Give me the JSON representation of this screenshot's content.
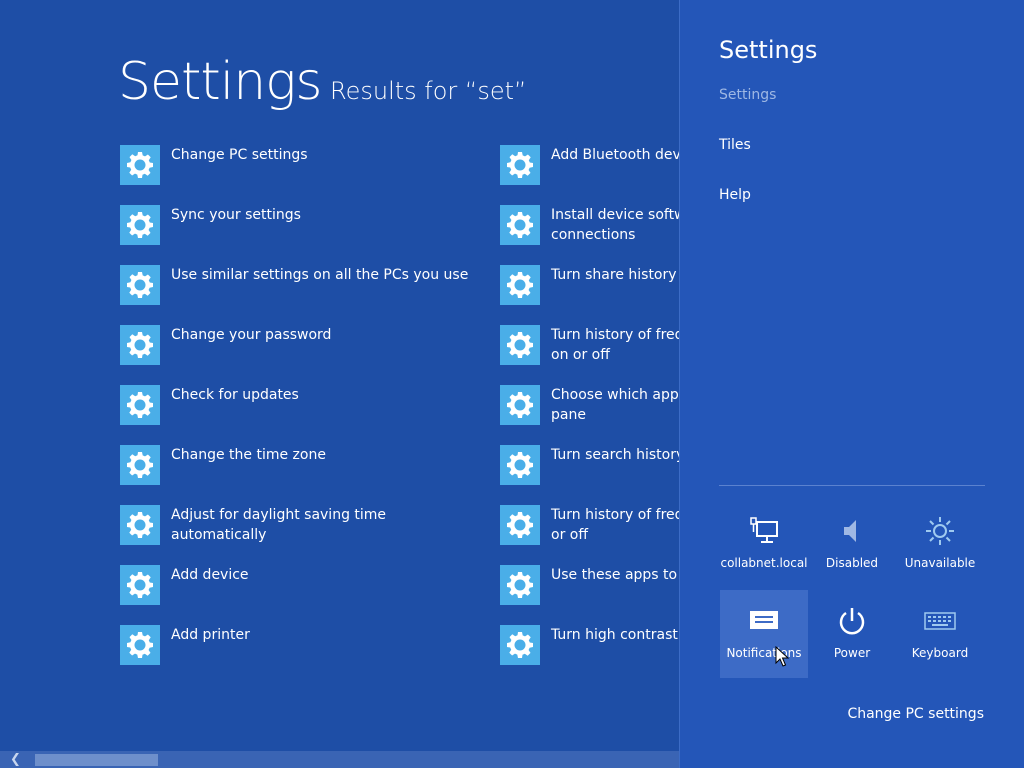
{
  "app": {
    "title": "Settings",
    "subtitle": "Results for “set”"
  },
  "results": {
    "left": [
      {
        "label": "Change PC settings",
        "icon": "gear-icon"
      },
      {
        "label": "Sync your settings",
        "icon": "gear-icon"
      },
      {
        "label": "Use similar settings on all the PCs you use",
        "icon": "gear-icon"
      },
      {
        "label": "Change your password",
        "icon": "gear-icon"
      },
      {
        "label": "Check for updates",
        "icon": "gear-icon"
      },
      {
        "label": "Change the time zone",
        "icon": "gear-icon"
      },
      {
        "label": "Adjust for daylight saving time automatically",
        "icon": "gear-icon"
      },
      {
        "label": "Add device",
        "icon": "gear-icon"
      },
      {
        "label": "Add printer",
        "icon": "gear-icon"
      }
    ],
    "right": [
      {
        "label": "Add Bluetooth devic",
        "icon": "gear-icon"
      },
      {
        "label": "Install device softwa connections",
        "icon": "gear-icon"
      },
      {
        "label": "Turn share history o",
        "icon": "gear-icon"
      },
      {
        "label": "Turn history of frequ on or off",
        "icon": "gear-icon"
      },
      {
        "label": "Choose which apps pane",
        "icon": "gear-icon"
      },
      {
        "label": "Turn search history o",
        "icon": "gear-icon"
      },
      {
        "label": "Turn history of frequ or off",
        "icon": "gear-icon"
      },
      {
        "label": "Use these apps to se",
        "icon": "gear-icon"
      },
      {
        "label": "Turn high contrast o",
        "icon": "gear-icon"
      }
    ]
  },
  "charm": {
    "title": "Settings",
    "links": [
      "Settings",
      "Tiles",
      "Help"
    ],
    "quick": [
      {
        "label": "collabnet.local",
        "icon": "network-icon"
      },
      {
        "label": "Disabled",
        "icon": "volume-icon"
      },
      {
        "label": "Unavailable",
        "icon": "brightness-icon"
      },
      {
        "label": "Notifications",
        "icon": "notifications-icon"
      },
      {
        "label": "Power",
        "icon": "power-icon"
      },
      {
        "label": "Keyboard",
        "icon": "keyboard-icon"
      }
    ],
    "footer_link": "Change PC settings"
  },
  "colors": {
    "app_background": "#1e4ea6",
    "charm_background": "#2456b8",
    "tile": "#4aaee8",
    "quick_active": "#3d6bc6"
  }
}
